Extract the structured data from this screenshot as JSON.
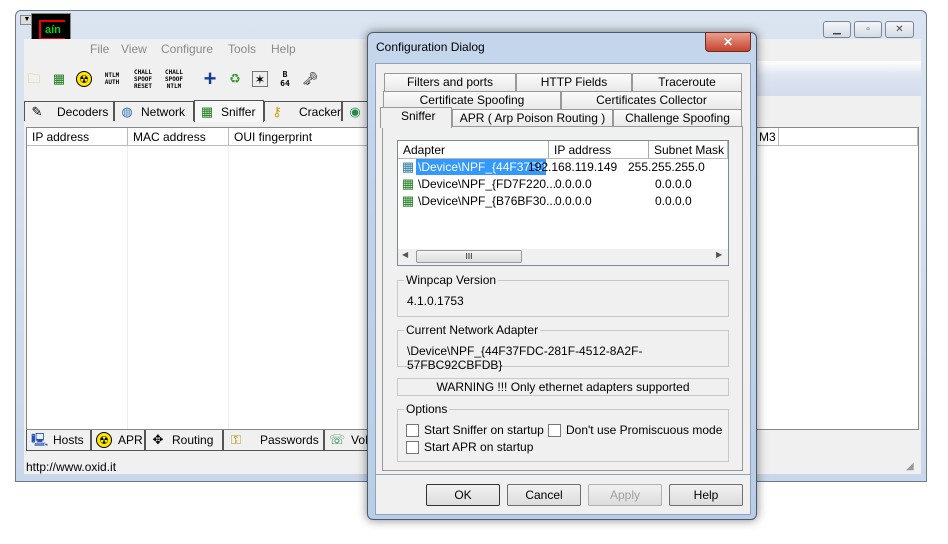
{
  "main": {
    "logo": "Cain",
    "menu": [
      "File",
      "View",
      "Configure",
      "Tools",
      "Help"
    ],
    "toolbar_labels": {
      "ntlm_auth": "NTLM AUTH",
      "chall_reset": "CHALL SPOOF RESET",
      "chall_ntlm": "CHALL SPOOF NTLM",
      "b64": "B 64"
    },
    "tabs": [
      "Decoders",
      "Network",
      "Sniffer",
      "Cracker"
    ],
    "columns": [
      "IP address",
      "MAC address",
      "OUI fingerprint"
    ],
    "column_partial": "M3",
    "bottom_tabs": [
      "Hosts",
      "APR",
      "Routing",
      "Passwords",
      "VoIP"
    ],
    "status": "http://www.oxid.it"
  },
  "dialog": {
    "title": "Configuration Dialog",
    "tabs_row1": [
      "Filters and ports",
      "HTTP Fields",
      "Traceroute"
    ],
    "tabs_row2": [
      "Certificate Spoofing",
      "Certificates Collector"
    ],
    "tabs_row3": [
      "Sniffer",
      "APR ( Arp Poison Routing )",
      "Challenge Spoofing"
    ],
    "active_tab": "Sniffer",
    "adapter_columns": [
      "Adapter",
      "IP address",
      "Subnet Mask"
    ],
    "adapters": [
      {
        "adapter": "\\Device\\NPF_{44F37FD...",
        "ip": "192.168.119.149",
        "mask": "255.255.255.0",
        "selected": true
      },
      {
        "adapter": "\\Device\\NPF_{FD7F220...",
        "ip": "0.0.0.0",
        "mask": "0.0.0.0"
      },
      {
        "adapter": "\\Device\\NPF_{B76BF30...",
        "ip": "0.0.0.0",
        "mask": "0.0.0.0"
      }
    ],
    "winpcap_label": "Winpcap Version",
    "winpcap_value": "4.1.0.1753",
    "current_adapter_label": "Current Network Adapter",
    "current_adapter_value": "\\Device\\NPF_{44F37FDC-281F-4512-8A2F-57FBC92CBFDB}",
    "warning": "WARNING !!! Only ethernet adapters supported",
    "options_label": "Options",
    "options": [
      "Start Sniffer on startup",
      "Don't use Promiscuous mode",
      "Start APR on startup"
    ],
    "buttons": [
      "OK",
      "Cancel",
      "Apply",
      "Help"
    ],
    "scroll_grip": "III"
  }
}
